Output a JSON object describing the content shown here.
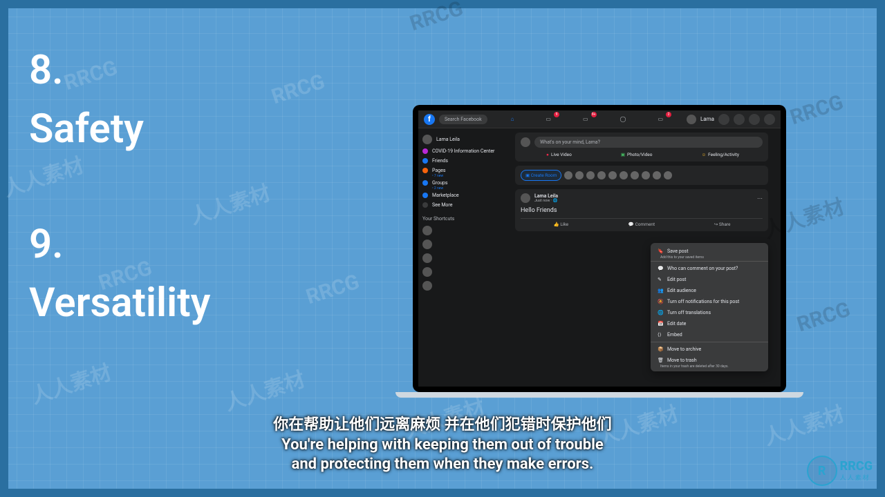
{
  "slide": {
    "item8_num": "8.",
    "item8_label": "Safety",
    "item9_num": "9.",
    "item9_label": "Versatility"
  },
  "fb": {
    "search_placeholder": "Search Facebook",
    "profile_name": "Lama",
    "left": {
      "user": "Lama Leila",
      "covid": "COVID-19 Information Center",
      "friends": "Friends",
      "pages": "Pages",
      "pages_sub": "• 7 new",
      "groups": "Groups",
      "groups_sub": "• 2 new",
      "marketplace": "Marketplace",
      "seemore": "See More",
      "shortcuts": "Your Shortcuts"
    },
    "center": {
      "whats": "What's on your mind, Lama?",
      "live": "Live Video",
      "photo": "Photo/Video",
      "feeling": "Feeling/Activity",
      "create_room": "Create Room",
      "post_name": "Lama Leila",
      "post_time": "Just now · ",
      "post_body": "Hello Friends",
      "like": "Like",
      "comment": "Comment",
      "share": "Share"
    },
    "menu": {
      "save": "Save post",
      "save_sub": "Add this to your saved items",
      "who": "Who can comment on your post?",
      "edit": "Edit post",
      "audience": "Edit audience",
      "turn_off": "Turn off notifications for this post",
      "translations": "Turn off translations",
      "date": "Edit date",
      "embed": "Embed",
      "archive": "Move to archive",
      "trash": "Move to trash",
      "trash_sub": "Items in your trash are deleted after 30 days."
    }
  },
  "subtitles": {
    "cn": "你在帮助让他们远离麻烦 并在他们犯错时保护他们",
    "en1": "You're helping with keeping them out of trouble",
    "en2": "and protecting them when they make errors."
  },
  "watermark": "RRCG",
  "watermark_cn": "人人素材",
  "brand": {
    "logo": "R",
    "name": "RRCG",
    "sub": "人人素材"
  }
}
